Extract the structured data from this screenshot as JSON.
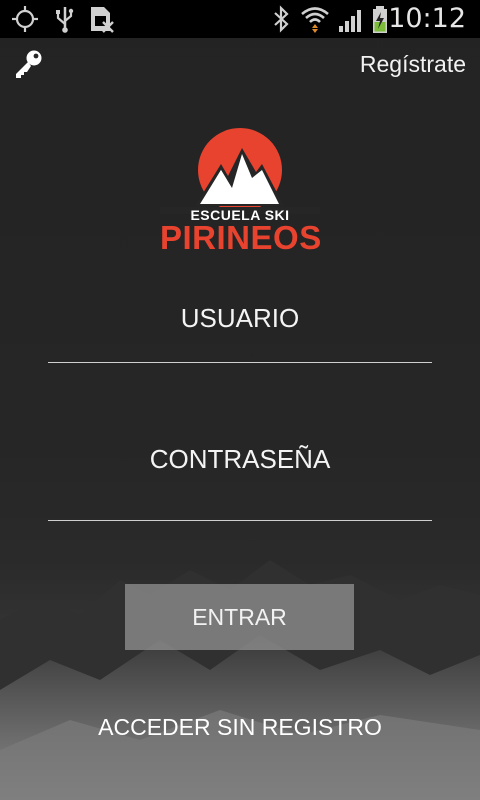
{
  "status_bar": {
    "time": "10:12",
    "icons": [
      "gps-icon",
      "usb-icon",
      "no-sim-icon",
      "bluetooth-icon",
      "wifi-icon",
      "signal-icon",
      "battery-charging-icon"
    ]
  },
  "header": {
    "key_icon": "key-icon",
    "register_label": "Regístrate"
  },
  "logo": {
    "subtitle": "ESCUELA SKI",
    "title": "PIRINEOS",
    "accent_color": "#e8432f"
  },
  "form": {
    "username_label": "USUARIO",
    "password_label": "CONTRASEÑA",
    "username_value": "",
    "password_value": "",
    "submit_label": "ENTRAR",
    "guest_label": "ACCEDER SIN REGISTRO"
  }
}
